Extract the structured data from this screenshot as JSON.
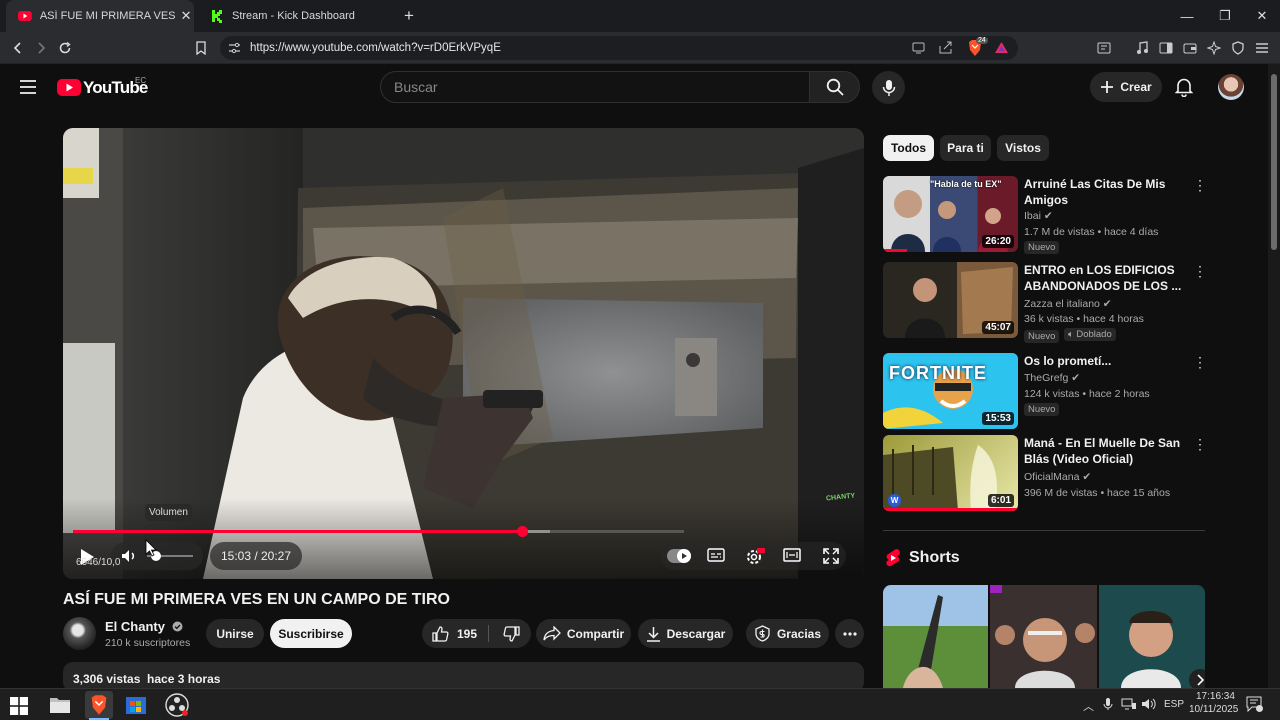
{
  "browser": {
    "tabs": [
      {
        "label": "ASÍ FUE MI PRIMERA VES EN UN",
        "icon": "youtube-icon",
        "active": true
      },
      {
        "label": "Stream - Kick Dashboard",
        "icon": "kick-icon",
        "active": false
      }
    ],
    "new_tab": "+",
    "url": "https://www.youtube.com/watch?v=rD0ErkVPyqE",
    "brave_badge": "24"
  },
  "youtube": {
    "logo_text": "YouTube",
    "region": "EC",
    "search_placeholder": "Buscar",
    "create_label": "Crear"
  },
  "player": {
    "tooltip": "Volumen",
    "time": "15:03 / 20:27",
    "overlay_frames": "6646/10,0",
    "progress_fraction": 0.735,
    "buffered_fraction": 0.78,
    "watermark": "CHANTY"
  },
  "video": {
    "title": "ASÍ FUE MI PRIMERA VES EN UN CAMPO DE TIRO",
    "channel": "El Chanty",
    "subscribers": "210 k suscriptores",
    "join_label": "Unirse",
    "subscribe_label": "Suscribirse",
    "likes": "195",
    "share_label": "Compartir",
    "download_label": "Descargar",
    "thanks_label": "Gracias",
    "views_date": "3,306 vistas  hace 3 horas"
  },
  "sidebar": {
    "chips": [
      "Todos",
      "Para ti",
      "Vistos"
    ],
    "recommendations": [
      {
        "title": "Arruiné Las Citas De Mis Amigos",
        "channel": "Ibai",
        "meta": "1.7 M de vistas • hace 4 días",
        "duration": "26:20",
        "badges": [
          "Nuevo"
        ],
        "thumb_text": "\"Habla de tu EX\""
      },
      {
        "title": "ENTRO en LOS EDIFICIOS ABANDONADOS DE LOS ...",
        "channel": "Zazza el italiano",
        "meta": "36 k vistas • hace 4 horas",
        "duration": "45:07",
        "badges": [
          "Nuevo",
          "Doblado"
        ]
      },
      {
        "title": "Os lo prometí...",
        "channel": "TheGrefg",
        "meta": "124 k vistas • hace 2 horas",
        "duration": "15:53",
        "badges": [
          "Nuevo"
        ],
        "thumb_text": "FORTNITE"
      },
      {
        "title": "Maná - En El Muelle De San Blás (Video Oficial)",
        "channel": "OficialMana",
        "meta": "396 M de vistas • hace 15 años",
        "duration": "6:01",
        "badges": []
      }
    ],
    "shorts_label": "Shorts"
  },
  "taskbar": {
    "language": "ESP",
    "time": "17:16:34",
    "date": "10/11/2025"
  },
  "colors": {
    "accent": "#ff0033",
    "background": "#0f0f0f"
  }
}
